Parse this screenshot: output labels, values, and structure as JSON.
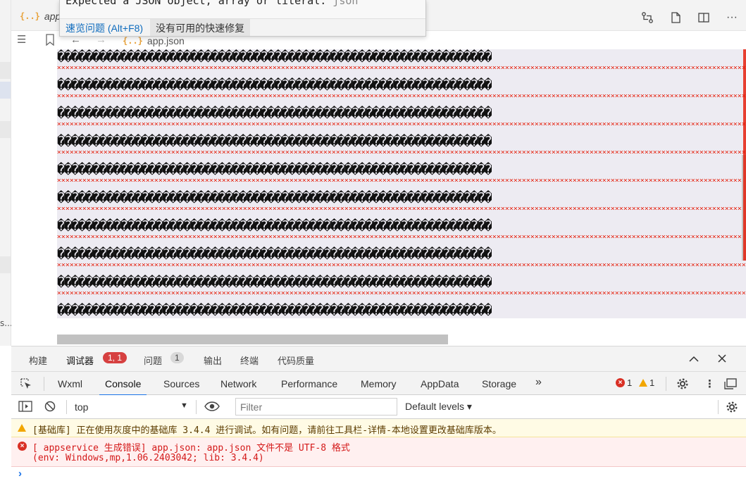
{
  "tab": {
    "label": "app"
  },
  "hover": {
    "message": "Expected a JSON object, array or literal.",
    "source": "json",
    "peek_link": "速览问题 (Alt+F8)",
    "no_fix": "没有可用的快速修复"
  },
  "editor": {
    "file_name": "app.json",
    "line_text": "��������������������������������������������������������������"
  },
  "left": {
    "ellipsis": "s..."
  },
  "panel": {
    "tabs": [
      "构建",
      "调试器",
      "问题",
      "输出",
      "终端",
      "代码质量"
    ],
    "debugger_badge": "1, 1",
    "problems_badge": "1"
  },
  "devtools": {
    "tabs": [
      "Wxml",
      "Console",
      "Sources",
      "Network",
      "Performance",
      "Memory",
      "AppData",
      "Storage"
    ],
    "more": "»",
    "error_count": "1",
    "warning_count": "1"
  },
  "console": {
    "context": "top",
    "filter_placeholder": "Filter",
    "levels": "Default levels",
    "warn_message": "[基础库] 正在使用灰度中的基础库 3.4.4 进行调试。如有问题，请前往工具栏-详情-本地设置更改基础库版本。",
    "error_line1": "[ appservice 生成错误] app.json: app.json 文件不是 UTF-8 格式",
    "error_line2": "(env: Windows,mp,1.06.2403042; lib: 3.4.4)",
    "prompt": "›"
  },
  "colors": {
    "error": "#d93025",
    "warning": "#f2a600",
    "accent": "#1a73e8",
    "squiggle": "#e51400"
  }
}
